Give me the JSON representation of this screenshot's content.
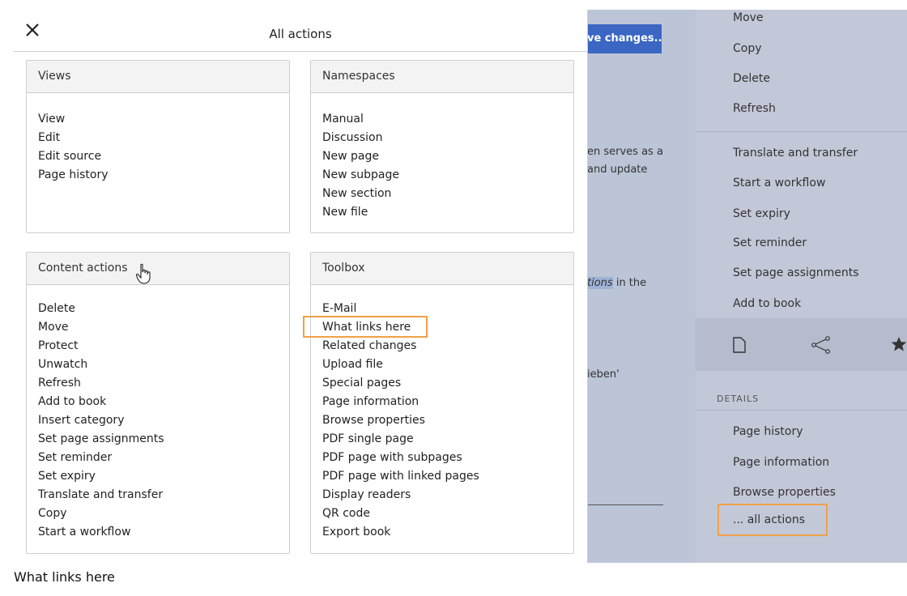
{
  "modal": {
    "title": "All actions",
    "views": {
      "title": "Views",
      "items": [
        "View",
        "Edit",
        "Edit source",
        "Page history"
      ]
    },
    "namespaces": {
      "title": "Namespaces",
      "items": [
        "Manual",
        "Discussion",
        "New page",
        "New subpage",
        "New section",
        "New file"
      ]
    },
    "content_actions": {
      "title": "Content actions",
      "items": [
        "Delete",
        "Move",
        "Protect",
        "Unwatch",
        "Refresh",
        "Add to book",
        "Insert category",
        "Set page assignments",
        "Set reminder",
        "Set expiry",
        "Translate and transfer",
        "Copy",
        "Start a workflow"
      ]
    },
    "toolbox": {
      "title": "Toolbox",
      "items": [
        "E-Mail",
        "What links here",
        "Related changes",
        "Upload file",
        "Special pages",
        "Page information",
        "Browse properties",
        "PDF single page",
        "PDF page with subpages",
        "PDF page with linked pages",
        "Display readers",
        "QR code",
        "Export book"
      ]
    }
  },
  "background": {
    "save_button": "ve changes...",
    "snippets": [
      "en serves as a",
      "and update",
      "in the",
      "ieben'"
    ],
    "highlight": "tions"
  },
  "sidebar": {
    "items_top": [
      "Move",
      "Copy",
      "Delete",
      "Refresh"
    ],
    "items_mid": [
      "Translate and transfer",
      "Start a workflow",
      "Set expiry",
      "Set reminder",
      "Set page assignments",
      "Add to book"
    ],
    "icons": [
      "page-icon",
      "share-icon",
      "star-icon"
    ],
    "details_heading": "DETAILS",
    "details_items": [
      "Page history",
      "Page information",
      "Browse properties",
      "... all actions"
    ]
  },
  "caption": "What links here",
  "colors": {
    "accent": "#3b66c4",
    "focus": "#f0a047",
    "sidebar": "#c3c8d8"
  }
}
